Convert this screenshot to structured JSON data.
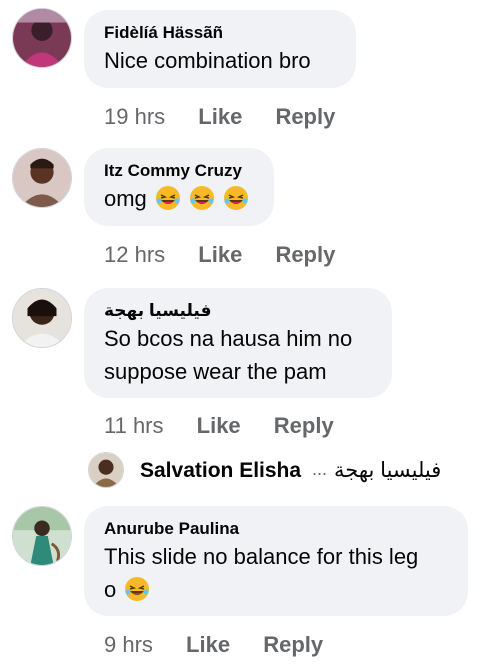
{
  "comments": [
    {
      "author": "Fidèlíá Hässãñ",
      "text_lines": [
        "Nice combination bro"
      ],
      "time": "19 hrs",
      "like_label": "Like",
      "reply_label": "Reply"
    },
    {
      "author": "Itz Commy Cruzy",
      "text_lines": [
        "omg"
      ],
      "emoji_after": [
        "rolling-laughing-emoji",
        "rolling-laughing-emoji",
        "rolling-laughing-emoji"
      ],
      "time": "12 hrs",
      "like_label": "Like",
      "reply_label": "Reply"
    },
    {
      "author": "فيليسيا بهجة",
      "text_lines": [
        "So bcos na hausa him no",
        "suppose wear the pam"
      ],
      "time": "11 hrs",
      "like_label": "Like",
      "reply_label": "Reply"
    },
    {
      "author": "Anurube Paulina",
      "text_lines": [
        "This slide no balance for this leg",
        "o"
      ],
      "emoji_after": [
        "rolling-laughing-emoji"
      ],
      "time": "9 hrs",
      "like_label": "Like",
      "reply_label": "Reply"
    }
  ],
  "reply_preview": {
    "name": "Salvation Elisha",
    "ellipsis": "...",
    "snippet": "فيليسيا بهجة"
  },
  "colors": {
    "bubble_bg": "#f0f2f5",
    "meta_text": "#65676b",
    "primary_text": "#050505"
  }
}
